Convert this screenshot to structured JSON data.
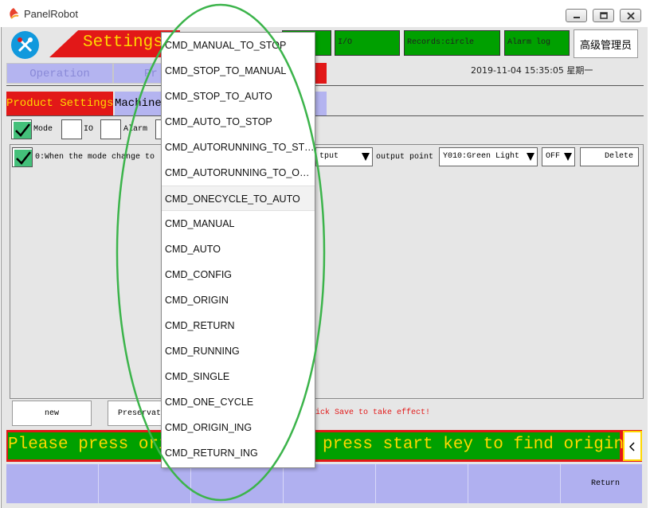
{
  "app": {
    "title": "PanelRobot"
  },
  "nav": {
    "settings_title": "Settings",
    "io_label": "I/O",
    "records_label": "Records:circle",
    "alarm_log_label": "Alarm log",
    "admin_label": "高级管理员",
    "operation_tab": "Operation",
    "program_tab": "Pr",
    "datetime": "2019-11-04  15:35:05  星期一"
  },
  "subtabs": {
    "product_settings": "Product Settings",
    "machine": "Machine",
    "tail": "s"
  },
  "filters": {
    "mode": {
      "label": "Mode",
      "checked": true
    },
    "io": {
      "label": "IO",
      "checked": false
    },
    "alarm": {
      "label": "Alarm",
      "checked": false
    }
  },
  "rule": {
    "checked": true,
    "description": "0:When the mode change to",
    "output_select": "tput",
    "output_point_label": "output point",
    "output_point_value": "Y010:Green Light",
    "state_value": "OFF",
    "delete_label": "Delete"
  },
  "actions": {
    "new_label": "new",
    "preserve_label": "Preservat",
    "save_hint": "lick Save to take effect!"
  },
  "message": {
    "left_text": "Please press ori",
    "right_text": "press start key to find origin"
  },
  "fkeys": {
    "return_label": "Return"
  },
  "dropdown": {
    "items": [
      "CMD_MANUAL_TO_STOP",
      "CMD_STOP_TO_MANUAL",
      "CMD_STOP_TO_AUTO",
      "CMD_AUTO_TO_STOP",
      "CMD_AUTORUNNING_TO_STOP",
      "CMD_AUTORUNNING_TO_ONECYCLE",
      "CMD_ONECYCLE_TO_AUTO",
      "CMD_MANUAL",
      "CMD_AUTO",
      "CMD_CONFIG",
      "CMD_ORIGIN",
      "CMD_RETURN",
      "CMD_RUNNING",
      "CMD_SINGLE",
      "CMD_ONE_CYCLE",
      "CMD_ORIGIN_ING",
      "CMD_RETURN_ING"
    ],
    "highlighted_index": 6
  },
  "colors": {
    "accent_red": "#e21818",
    "accent_green": "#00a000",
    "accent_yellow": "#ffd800",
    "tab_blue": "#b4b4f0",
    "annotation_green": "#3cb44b"
  }
}
